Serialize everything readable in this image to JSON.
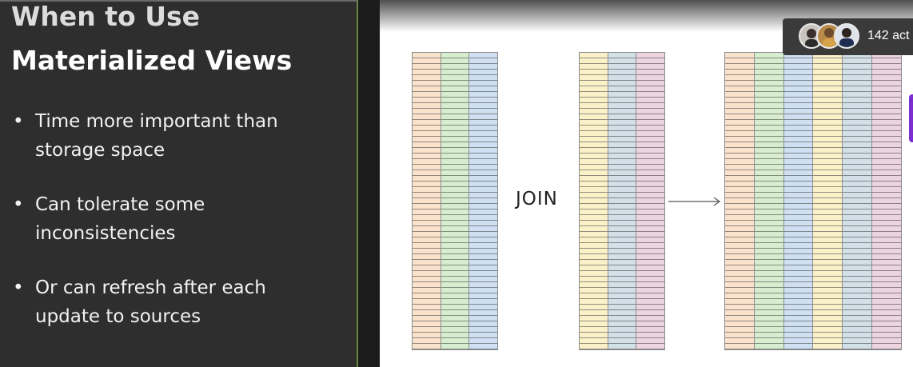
{
  "slide": {
    "title_line1": "When to Use",
    "title_line2": "Materialized Views",
    "bullets": [
      {
        "line1": "Time more important than",
        "line2": "storage space"
      },
      {
        "line1": "Can tolerate some",
        "line2": "inconsistencies"
      },
      {
        "line1": "Or can refresh after each",
        "line2": "update to sources"
      }
    ],
    "join_label": "JOIN",
    "tables": [
      {
        "name": "left-table",
        "column_colors": [
          "#fbe2cc",
          "#d7edd0",
          "#cfe0f3"
        ]
      },
      {
        "name": "right-table",
        "column_colors": [
          "#fbf1c9",
          "#d3e0e8",
          "#ecd4e0"
        ]
      },
      {
        "name": "result-table",
        "column_colors": [
          "#fbe2cc",
          "#d7edd0",
          "#cfe0f3",
          "#fbf1c9",
          "#d3e0e8",
          "#ecd4e0"
        ]
      }
    ]
  },
  "meeting": {
    "participant_count_text": "142 act",
    "avatars": [
      "participant-avatar-1",
      "participant-avatar-2",
      "participant-avatar-3"
    ]
  },
  "colors": {
    "panel_bg": "#2e2e2e",
    "accent_purple": "#7a2fd0"
  }
}
